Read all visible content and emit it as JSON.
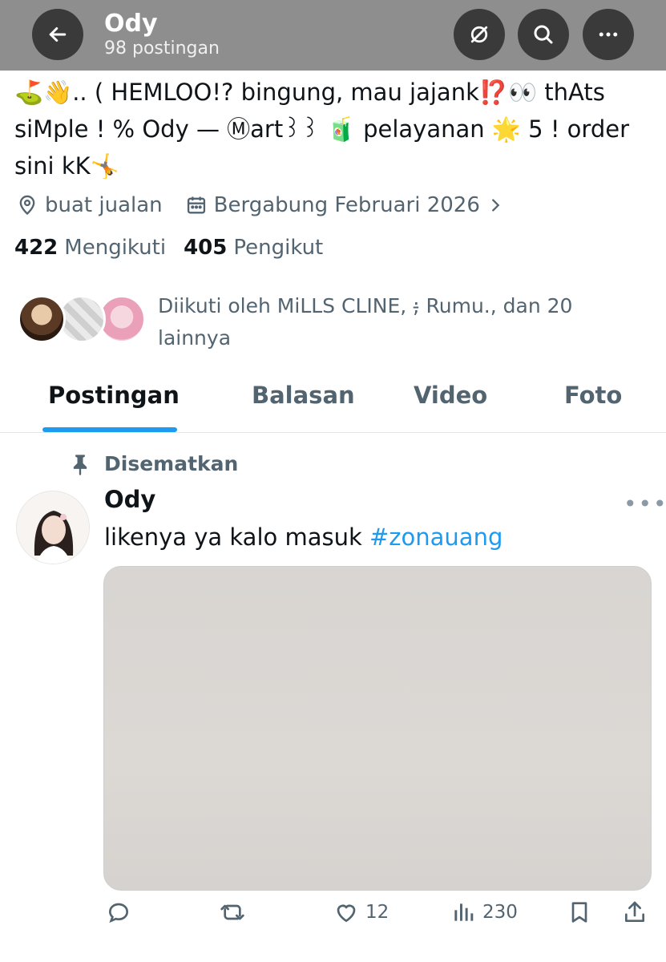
{
  "header": {
    "name": "Ody",
    "post_count": "98 postingan",
    "icons": [
      "back-arrow-icon",
      "hide-icon",
      "search-icon",
      "more-icon"
    ]
  },
  "profile": {
    "bio": "⛳👋.. ( HEMLOO!? bingung, mau jajank⁉️👀 thAts siMple ! % Ody — Ⓜart꒱꒱ 🧃 pelayanan 🌟 5 ! order sini kK🤸",
    "location": "buat jualan",
    "joined": "Bergabung Februari 2026",
    "following_count": "422",
    "following_label": "Mengikuti",
    "followers_count": "405",
    "followers_label": "Pengikut",
    "followed_by": "Diikuti oleh MiLLS CLINE, ;̵ Rumu., dan 20 lainnya"
  },
  "tabs": [
    {
      "label": "Postingan",
      "active": true
    },
    {
      "label": "Balasan",
      "active": false
    },
    {
      "label": "Video",
      "active": false
    },
    {
      "label": "Foto",
      "active": false
    }
  ],
  "post": {
    "pinned_label": "Disematkan",
    "author": "Ody",
    "text": "likenya ya kalo masuk ",
    "hashtag": "#zonauang",
    "likes": "12",
    "views": "230"
  },
  "colors": {
    "accent": "#1d9bf0",
    "header_bg": "#8e8e8e",
    "secondary_text": "#536471"
  }
}
